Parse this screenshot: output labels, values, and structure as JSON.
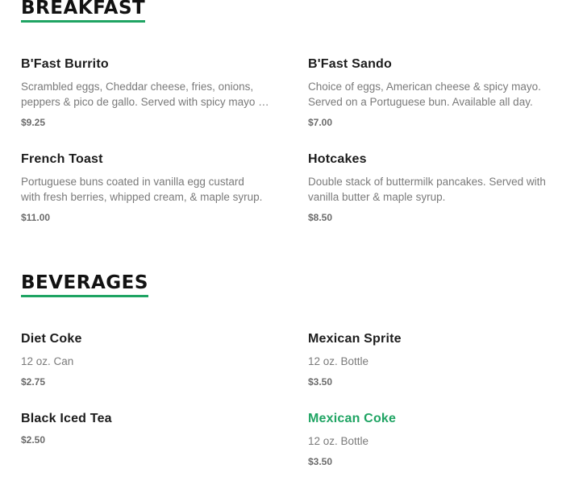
{
  "sections": [
    {
      "title": "BREAKFAST",
      "items": [
        {
          "name": "B'Fast Burrito",
          "desc_lines": [
            "Scrambled eggs, Cheddar cheese, fries, onions,",
            "peppers & pico de gallo. Served with spicy mayo …"
          ],
          "price": "$9.25"
        },
        {
          "name": "B'Fast Sando",
          "desc_lines": [
            "Choice of eggs, American cheese & spicy mayo.",
            "Served on a Portuguese bun. Available all day."
          ],
          "price": "$7.00"
        },
        {
          "name": "French Toast",
          "desc_lines": [
            "Portuguese buns coated in vanilla egg custard",
            "with fresh berries, whipped cream, & maple syrup."
          ],
          "price": "$11.00"
        },
        {
          "name": "Hotcakes",
          "desc_lines": [
            "Double stack of buttermilk pancakes. Served with",
            "vanilla butter & maple syrup."
          ],
          "price": "$8.50"
        }
      ]
    },
    {
      "title": "BEVERAGES",
      "items": [
        {
          "name": "Diet Coke",
          "desc_lines": [
            "12 oz. Can"
          ],
          "price": "$2.75"
        },
        {
          "name": "Mexican Sprite",
          "desc_lines": [
            "12 oz. Bottle"
          ],
          "price": "$3.50"
        },
        {
          "name": "Black Iced Tea",
          "desc_lines": [],
          "price": "$2.50"
        },
        {
          "name": "Mexican Coke",
          "desc_lines": [
            "12 oz. Bottle"
          ],
          "price": "$3.50",
          "highlighted": true
        }
      ]
    }
  ],
  "colors": {
    "accent": "#1fa463",
    "heading": "#121212",
    "item_name": "#1c1c1c",
    "description": "#7a7a7a",
    "price": "#6b6b6b"
  }
}
